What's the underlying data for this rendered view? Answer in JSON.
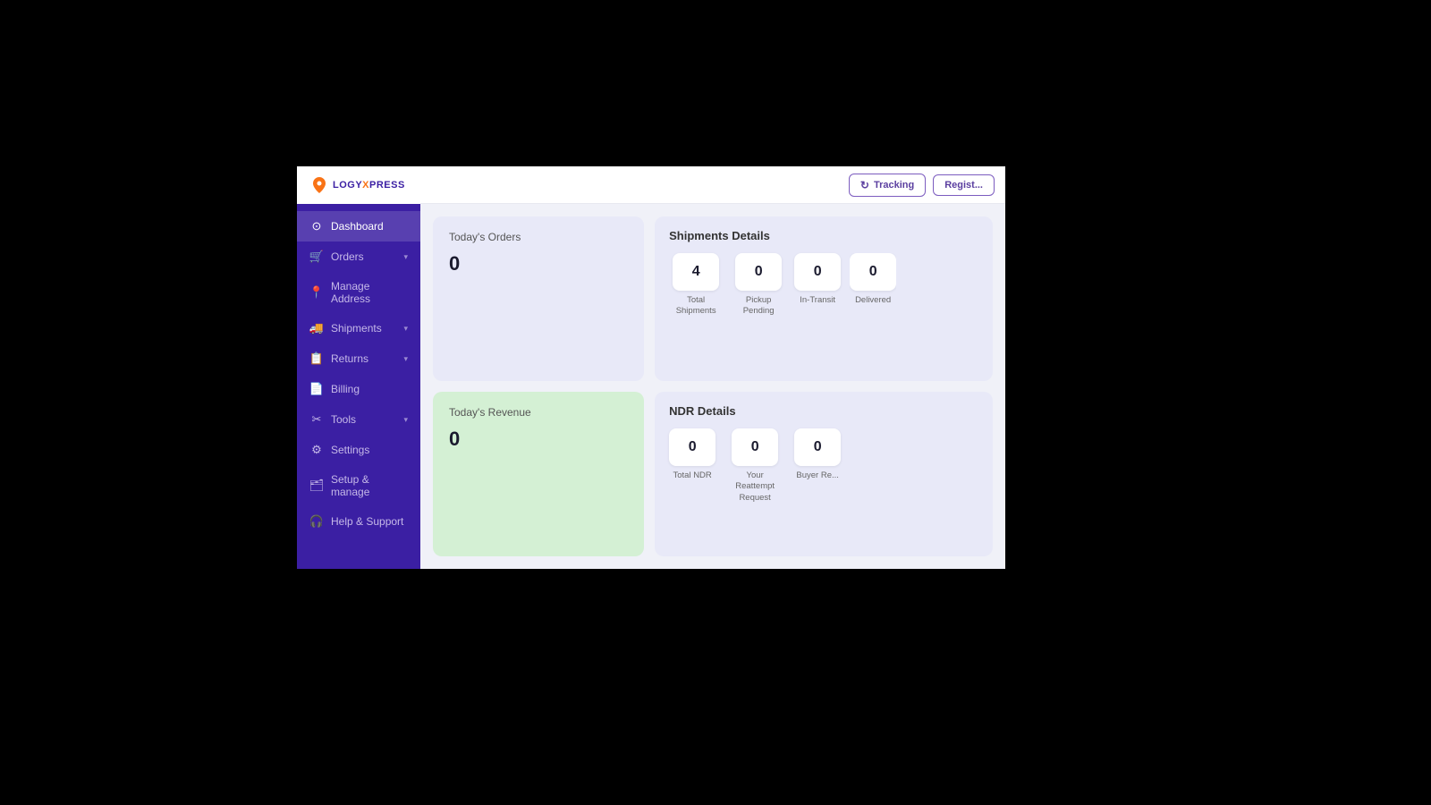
{
  "logo": {
    "name_prefix": "LOGY",
    "name_x": "X",
    "name_suffix": "PRESS"
  },
  "header": {
    "tracking_label": "Tracking",
    "register_label": "Regist..."
  },
  "sidebar": {
    "items": [
      {
        "id": "dashboard",
        "label": "Dashboard",
        "icon": "⊙",
        "active": true,
        "has_chevron": false
      },
      {
        "id": "orders",
        "label": "Orders",
        "icon": "🛒",
        "active": false,
        "has_chevron": true
      },
      {
        "id": "manage-address",
        "label": "Manage Address",
        "icon": "📍",
        "active": false,
        "has_chevron": false
      },
      {
        "id": "shipments",
        "label": "Shipments",
        "icon": "🚚",
        "active": false,
        "has_chevron": true
      },
      {
        "id": "returns",
        "label": "Returns",
        "icon": "📋",
        "active": false,
        "has_chevron": true
      },
      {
        "id": "billing",
        "label": "Billing",
        "icon": "📄",
        "active": false,
        "has_chevron": false
      },
      {
        "id": "tools",
        "label": "Tools",
        "icon": "✂",
        "active": false,
        "has_chevron": true
      },
      {
        "id": "settings",
        "label": "Settings",
        "icon": "⚙",
        "active": false,
        "has_chevron": false
      },
      {
        "id": "setup-manage",
        "label": "Setup & manage",
        "icon": "🗂",
        "active": false,
        "has_chevron": false
      },
      {
        "id": "help-support",
        "label": "Help & Support",
        "icon": "🎧",
        "active": false,
        "has_chevron": false
      }
    ]
  },
  "dashboard": {
    "todays_orders": {
      "label": "Today's Orders",
      "value": "0"
    },
    "todays_revenue": {
      "label": "Today's Revenue",
      "value": "0"
    },
    "shipments_details": {
      "title": "Shipments Details",
      "stats": [
        {
          "label": "Total Shipments",
          "value": "4"
        },
        {
          "label": "Pickup Pending",
          "value": "0"
        },
        {
          "label": "In-Transit",
          "value": "0"
        },
        {
          "label": "Delivered",
          "value": "0"
        }
      ]
    },
    "ndr_details": {
      "title": "NDR Details",
      "stats": [
        {
          "label": "Total NDR",
          "value": "0"
        },
        {
          "label": "Your Reattempt Request",
          "value": "0"
        },
        {
          "label": "Buyer Re...",
          "value": "0"
        }
      ]
    }
  },
  "colors": {
    "sidebar_bg": "#3b1fa3",
    "card_purple": "#e8e9f8",
    "card_green": "#d4f0d4",
    "accent": "#5b3fa0"
  }
}
